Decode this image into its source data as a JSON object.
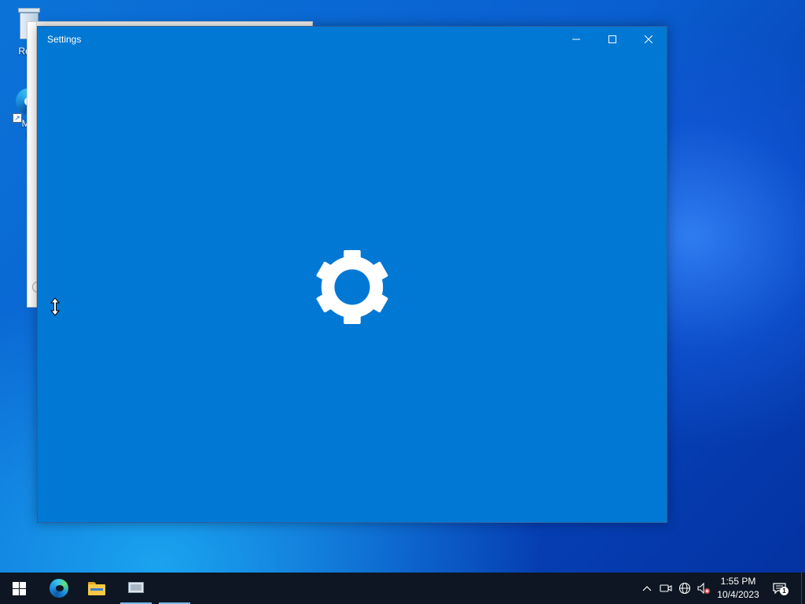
{
  "desktop": {
    "icons": [
      {
        "label": "Recy"
      },
      {
        "label": "Mic",
        "label2": "E"
      }
    ]
  },
  "settings_window": {
    "title": "Settings"
  },
  "taskbar": {
    "clock": {
      "time": "1:55 PM",
      "date": "10/4/2023"
    },
    "notifications": {
      "count": "1"
    }
  },
  "colors": {
    "accent": "#0178d4",
    "taskbar": "#0d1622",
    "running_indicator": "#76b9ed"
  }
}
